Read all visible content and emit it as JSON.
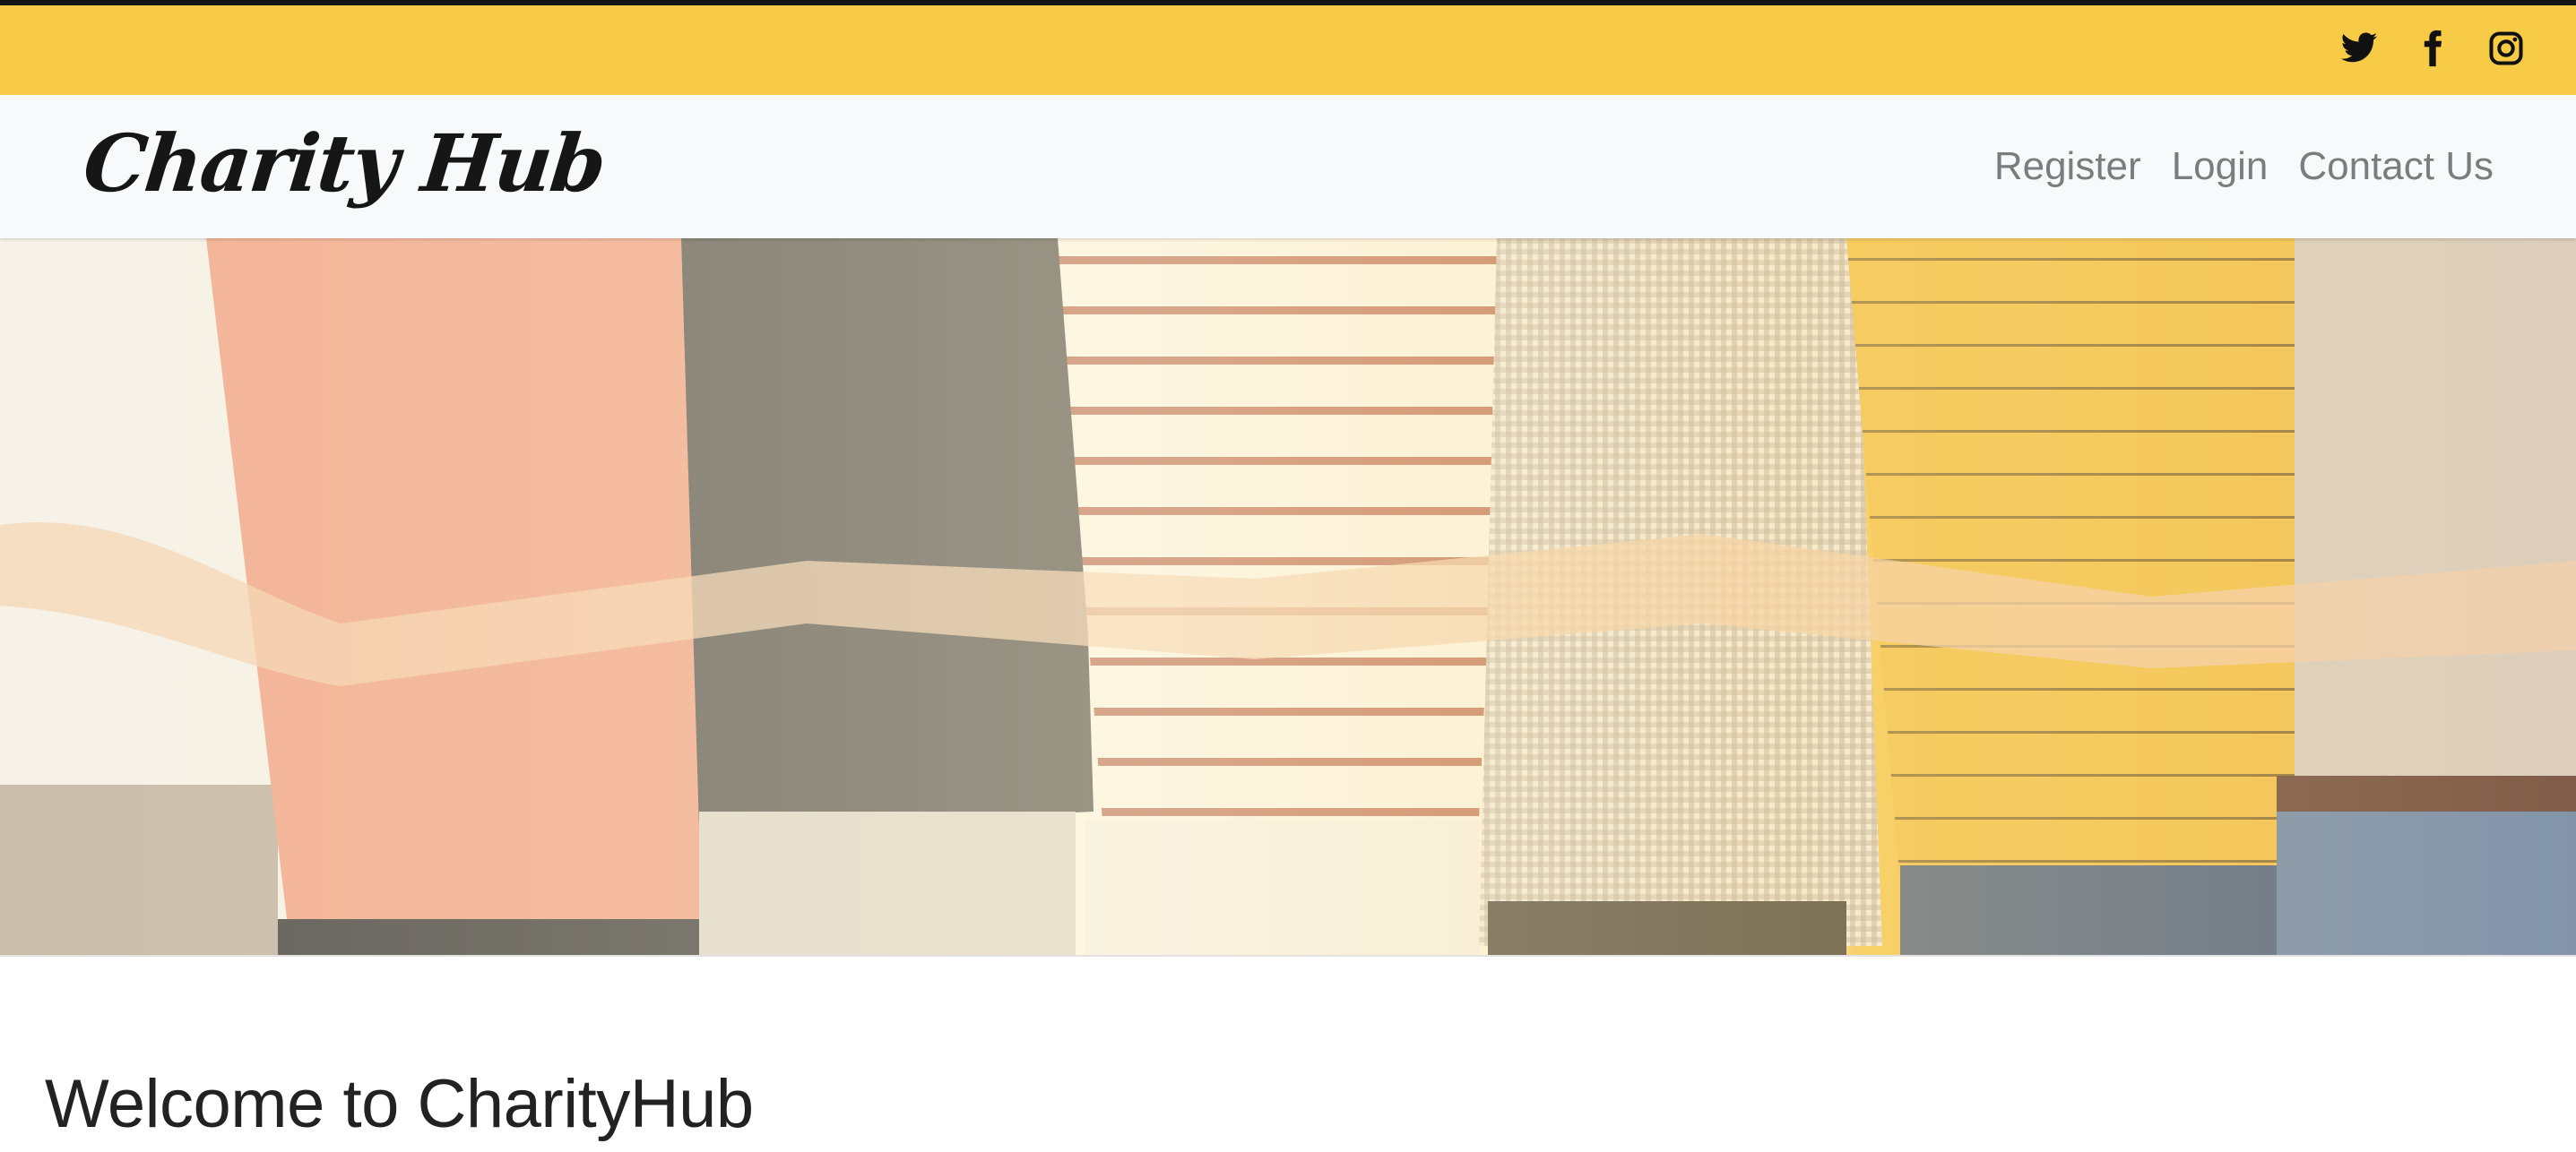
{
  "header": {
    "accent_color": "#f7cb46",
    "social_icons": [
      "twitter-icon",
      "facebook-icon",
      "instagram-icon"
    ]
  },
  "navbar": {
    "brand": "Charity Hub",
    "links": [
      "Register",
      "Login",
      "Contact Us"
    ]
  },
  "hero": {
    "image_description": "people linking arms"
  },
  "main": {
    "welcome_title": "Welcome to CharityHub"
  }
}
